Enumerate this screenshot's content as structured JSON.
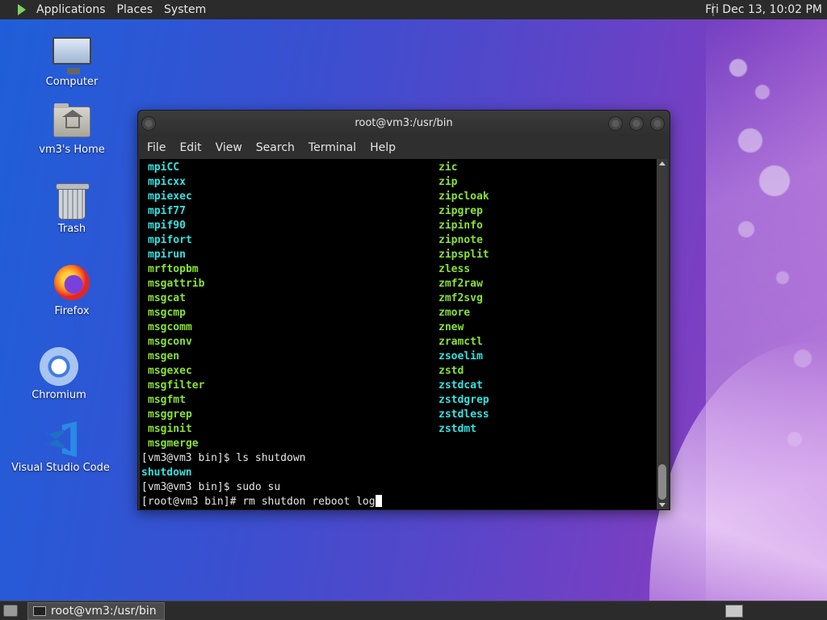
{
  "top_panel": {
    "menus": [
      "Applications",
      "Places",
      "System"
    ],
    "clock": "Fri Dec 13, 10:02 PM"
  },
  "desktop_icons": [
    {
      "label": "Computer",
      "icon": "computer-icon"
    },
    {
      "label": "vm3's Home",
      "icon": "home-folder-icon"
    },
    {
      "label": "Trash",
      "icon": "trash-icon"
    },
    {
      "label": "Firefox",
      "icon": "firefox-icon"
    },
    {
      "label": "Chromium",
      "icon": "chromium-icon"
    },
    {
      "label": "Visual Studio Code",
      "icon": "vscode-icon"
    }
  ],
  "window": {
    "title": "root@vm3:/usr/bin",
    "menu": [
      "File",
      "Edit",
      "View",
      "Search",
      "Terminal",
      "Help"
    ]
  },
  "terminal": {
    "listing": [
      [
        "mpiCC",
        "zic"
      ],
      [
        "mpicxx",
        "zip"
      ],
      [
        "mpiexec",
        "zipcloak"
      ],
      [
        "mpif77",
        "zipgrep"
      ],
      [
        "mpif90",
        "zipinfo"
      ],
      [
        "mpifort",
        "zipnote"
      ],
      [
        "mpirun",
        "zipsplit"
      ],
      [
        "mrftopbm",
        "zless"
      ],
      [
        "msgattrib",
        "zmf2raw"
      ],
      [
        "msgcat",
        "zmf2svg"
      ],
      [
        "msgcmp",
        "zmore"
      ],
      [
        "msgcomm",
        "znew"
      ],
      [
        "msgconv",
        "zramctl"
      ],
      [
        "msgen",
        "zsoelim"
      ],
      [
        "msgexec",
        "zstd"
      ],
      [
        "msgfilter",
        "zstdcat"
      ],
      [
        "msgfmt",
        "zstdgrep"
      ],
      [
        "msggrep",
        "zstdless"
      ],
      [
        "msginit",
        "zstdmt"
      ],
      [
        "msgmerge",
        ""
      ]
    ],
    "col1_colors": [
      "cyan",
      "cyan",
      "cyan",
      "cyan",
      "cyan",
      "cyan",
      "cyan",
      "green",
      "green",
      "green",
      "green",
      "green",
      "green",
      "green",
      "green",
      "green",
      "green",
      "green",
      "green",
      "green"
    ],
    "col2_colors": [
      "green",
      "green",
      "green",
      "green",
      "green",
      "green",
      "green",
      "green",
      "green",
      "green",
      "green",
      "green",
      "green",
      "cyan",
      "green",
      "cyan",
      "cyan",
      "cyan",
      "cyan",
      ""
    ],
    "lines": [
      {
        "text": "[vm3@vm3 bin]$ ls shutdown",
        "color": "plain"
      },
      {
        "text": "shutdown",
        "color": "cyan"
      },
      {
        "text": "[vm3@vm3 bin]$ sudo su",
        "color": "plain"
      },
      {
        "text": "[root@vm3 bin]# rm shutdon reboot log",
        "color": "plain"
      }
    ]
  },
  "taskbar": {
    "task_label": "root@vm3:/usr/bin"
  },
  "colors": {
    "green": "#8ae234",
    "cyan": "#34e2e2"
  }
}
